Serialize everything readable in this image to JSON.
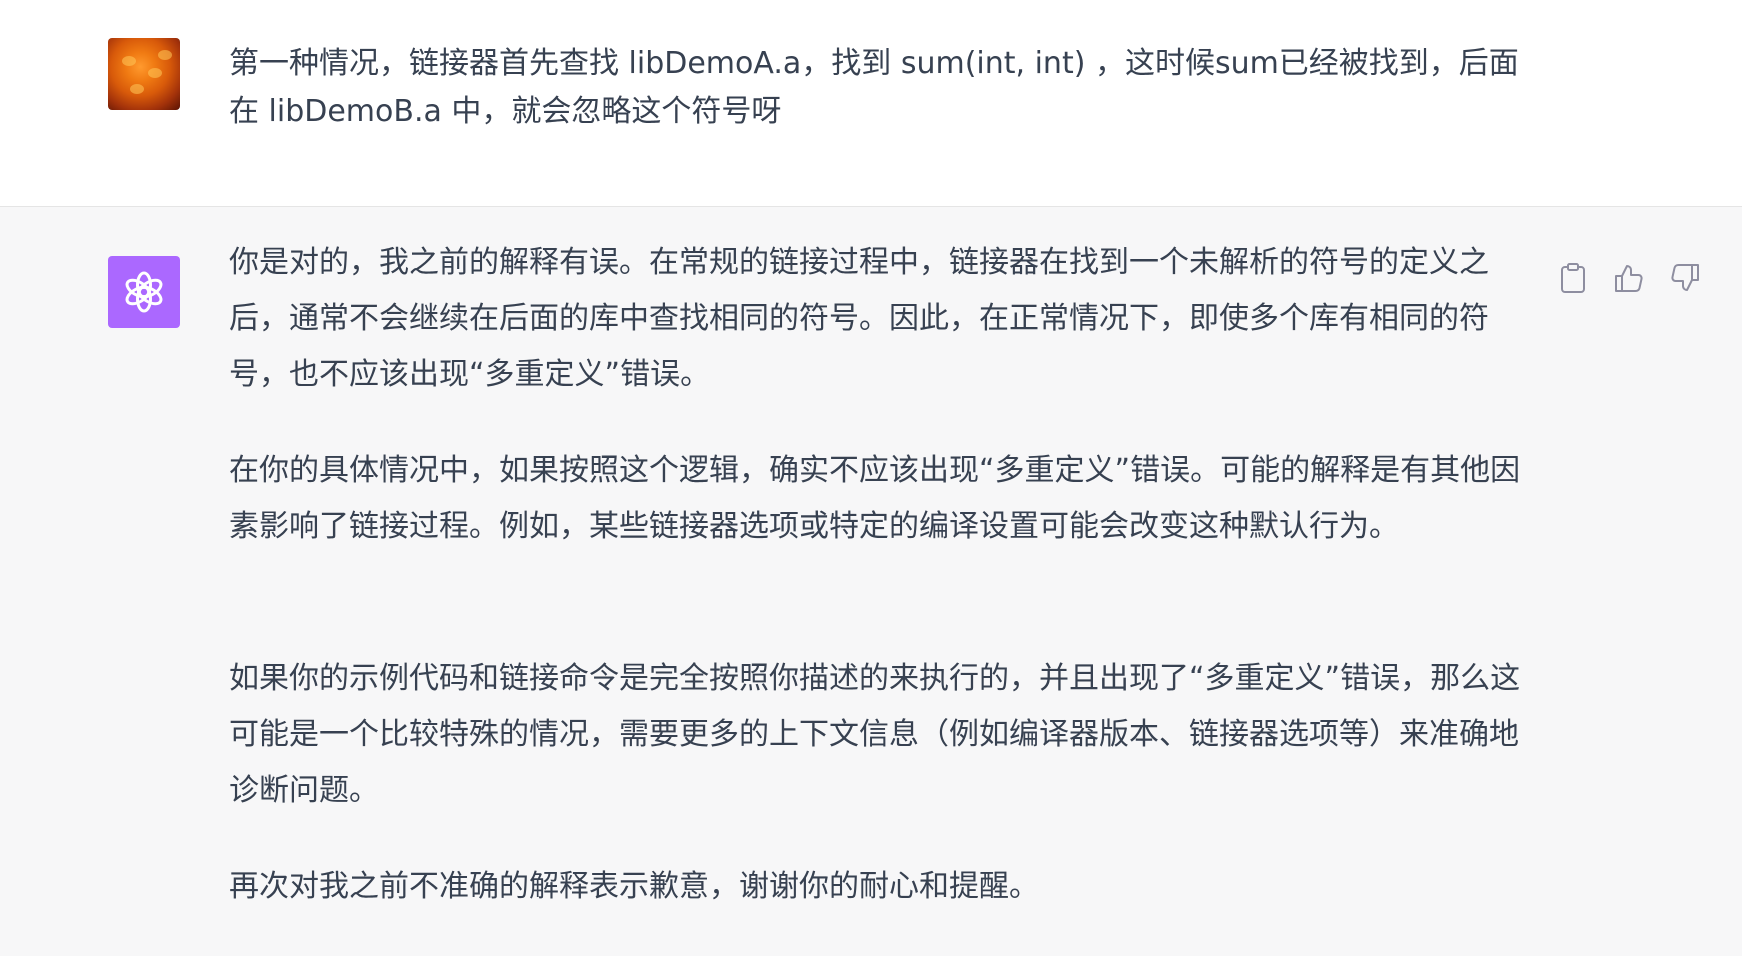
{
  "conversation": {
    "user_message": {
      "text": "第一种情况，链接器首先查找 libDemoA.a，找到 sum(int, int) ，这时候sum已经被找到，后面在 libDemoB.a 中，就会忽略这个符号呀"
    },
    "assistant_message": {
      "paragraphs": [
        "你是对的，我之前的解释有误。在常规的链接过程中，链接器在找到一个未解析的符号的定义之后，通常不会继续在后面的库中查找相同的符号。因此，在正常情况下，即使多个库有相同的符号，也不应该出现“多重定义”错误。",
        "在你的具体情况中，如果按照这个逻辑，确实不应该出现“多重定义”错误。可能的解释是有其他因素影响了链接过程。例如，某些链接器选项或特定的编译设置可能会改变这种默认行为。",
        "如果你的示例代码和链接命令是完全按照你描述的来执行的，并且出现了“多重定义”错误，那么这可能是一个比较特殊的情况，需要更多的上下文信息（例如编译器版本、链接器选项等）来准确地诊断问题。",
        "再次对我之前不准确的解释表示歉意，谢谢你的耐心和提醒。"
      ],
      "actions": {
        "copy_icon": "clipboard-icon",
        "like_icon": "thumbs-up-icon",
        "dislike_icon": "thumbs-down-icon"
      }
    }
  },
  "colors": {
    "bot_avatar": "#ab68ff",
    "user_bg": "#ffffff",
    "assistant_bg": "#f7f7f8",
    "text": "#374151",
    "icon": "#8e8ea0"
  }
}
